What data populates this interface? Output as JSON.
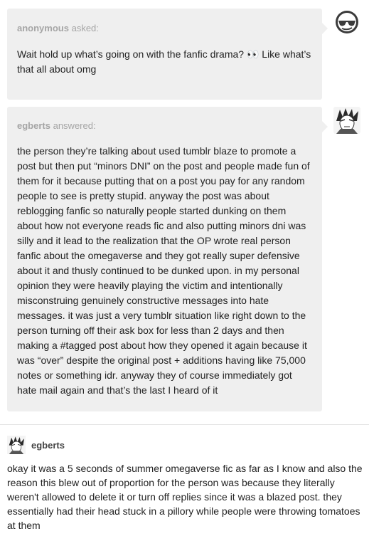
{
  "ask": {
    "author": "anonymous",
    "verb": "asked:",
    "message": "Wait hold up what’s going on with the fanfic drama? 👀 Like what’s that all about omg",
    "avatar_icon": "sunglasses-face-icon"
  },
  "answer": {
    "author": "egberts",
    "verb": "answered:",
    "message": "the person they’re talking about used tumblr blaze to promote a post but then put “minors DNI” on the post and people made fun of them for it because putting that on a post you pay for any random people to see is pretty stupid. anyway the post was about reblogging fanfic so naturally people started dunking on them about how not everyone reads fic and also putting minors dni was silly and it lead to the realization that the OP wrote real person fanfic about the omegaverse and they got really super defensive about it and thusly continued to be dunked upon. in my personal opinion they were heavily playing the victim and intentionally misconstruing genuinely constructive messages into hate messages. it was just a very tumblr situation like right down to the person turning off their ask box for less than 2 days and then making a #tagged post about how they opened it again because it was “over” despite the original post + additions having like 75,000 notes or something idr. anyway they of course immediately got hate mail again and that’s the last I heard of it",
    "avatar_icon": "manga-character-avatar-icon"
  },
  "reblog": {
    "author": "egberts",
    "avatar_icon": "manga-character-avatar-icon",
    "message": "okay it was a 5 seconds of summer omegaverse fic as far as I know and also the reason this blew out of proportion for the person was because they literally weren't allowed to delete it or turn off replies since it was a blazed post. they essentially had their head stuck in a pillory while people were throwing tomatoes at them"
  }
}
